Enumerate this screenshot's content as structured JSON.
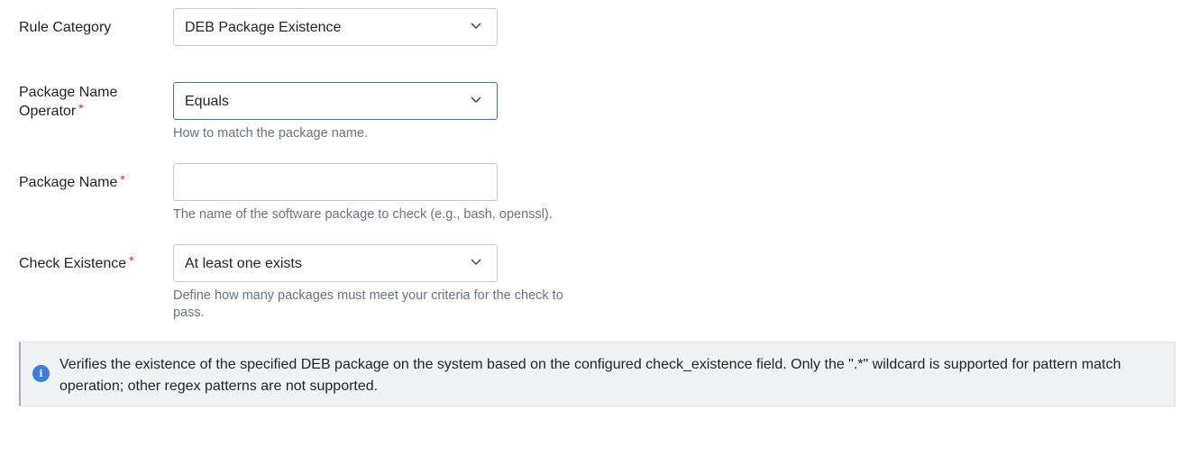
{
  "form": {
    "rule_category": {
      "label": "Rule Category",
      "value": "DEB Package Existence"
    },
    "package_name_operator": {
      "label_line1": "Package Name",
      "label_line2": "Operator",
      "required_mark": "*",
      "value": "Equals",
      "help": "How to match the package name."
    },
    "package_name": {
      "label": "Package Name",
      "required_mark": "*",
      "value": "",
      "placeholder": "",
      "help": "The name of the software package to check (e.g., bash, openssl)."
    },
    "check_existence": {
      "label": "Check Existence",
      "required_mark": "*",
      "value": "At least one exists",
      "help": "Define how many packages must meet your criteria for the check to pass."
    }
  },
  "info": {
    "icon": "info-icon",
    "text": "Verifies the existence of the specified DEB package on the system based on the configured check_existence field. Only the \".*\" wildcard is supported for pattern match operation; other regex patterns are not supported."
  },
  "colors": {
    "required": "#d93025",
    "focus_border": "#3b6fc4",
    "info_icon": "#3b7be0",
    "info_background": "#f1f2f4",
    "help_text": "#6b7280"
  }
}
